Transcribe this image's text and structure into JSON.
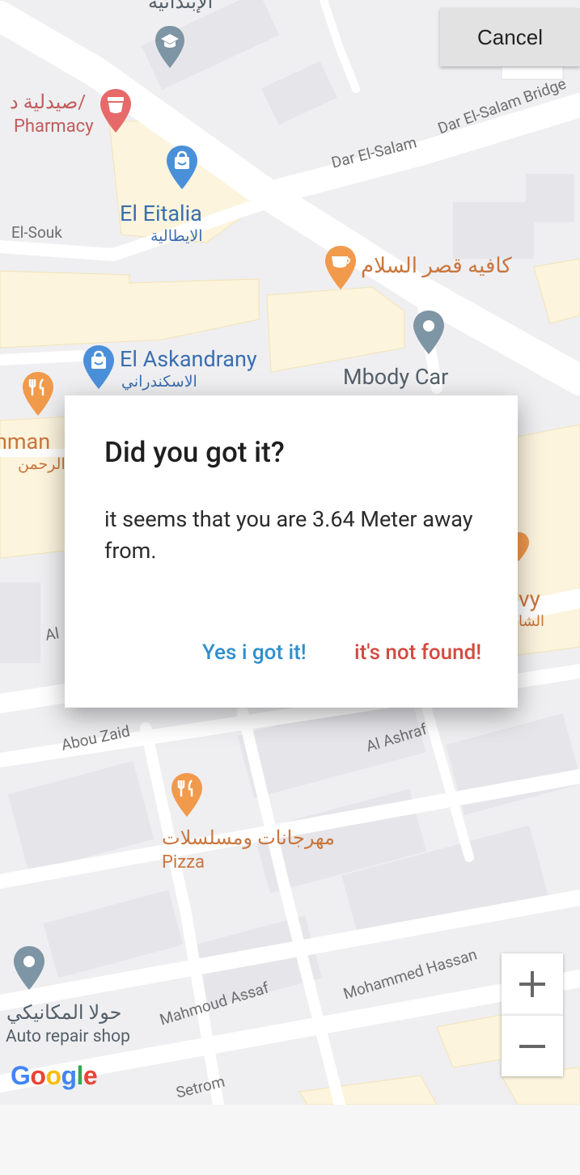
{
  "top_action": {
    "cancel_label": "Cancel"
  },
  "map": {
    "streets": {
      "dar_el_salam": "Dar El-Salam",
      "dar_el_salam_bridge": "Dar El-Salam Bridge",
      "el_souk": "El-Souk",
      "abou_zaid": "Abou Zaid",
      "al_ashraf": "Al Ashraf",
      "mahmoud_assaf": "Mahmoud Assaf",
      "mohammed_hassan": "Mohammed Hassan",
      "setrom": "Setrom",
      "al_fragment": "Al"
    },
    "places": {
      "school_ar": "الإبتدائية",
      "pharmacy_ar": "صيدلية د/",
      "pharmacy_en": "Pharmacy",
      "eitalia_en": "El Eitalia",
      "eitalia_ar": "الايطالية",
      "cafe_ar": "كافيه قصر السلام",
      "askandrany_en": "El Askandrany",
      "askandrany_ar": "الاسكندراني",
      "mbody_en": "Mbody Car",
      "rahman_en_fragment": "hman",
      "rahman_ar_fragment": "الرحمن",
      "vy_fragment": "vy",
      "vy_ar_fragment": "الشا",
      "pizza_ar": "مهرجانات ومسلسلات",
      "pizza_en": "Pizza",
      "repair_ar": "حولا المكانيكي",
      "repair_en": "Auto repair shop"
    },
    "controls": {
      "zoom_in": "+",
      "zoom_out": "−"
    },
    "logo": {
      "g1": "G",
      "o1": "o",
      "o2": "o",
      "g2": "g",
      "l": "l",
      "e": "e"
    },
    "logo_colors": {
      "blue": "#4285F4",
      "red": "#EA4335",
      "yellow": "#FBBC05",
      "green": "#34A853"
    }
  },
  "dialog": {
    "title": "Did you got it?",
    "message": "it seems that you are 3.64 Meter away from.",
    "confirm_label": "Yes i got it!",
    "deny_label": "it's not found!"
  },
  "colors": {
    "accent_blue": "#2f8fcf",
    "accent_red": "#d24b3f",
    "map_pin_blue": "#4a90d9",
    "map_pin_orange": "#f19a4c",
    "map_pin_red": "#e66a6a",
    "map_pin_gray": "#7d95a4"
  }
}
